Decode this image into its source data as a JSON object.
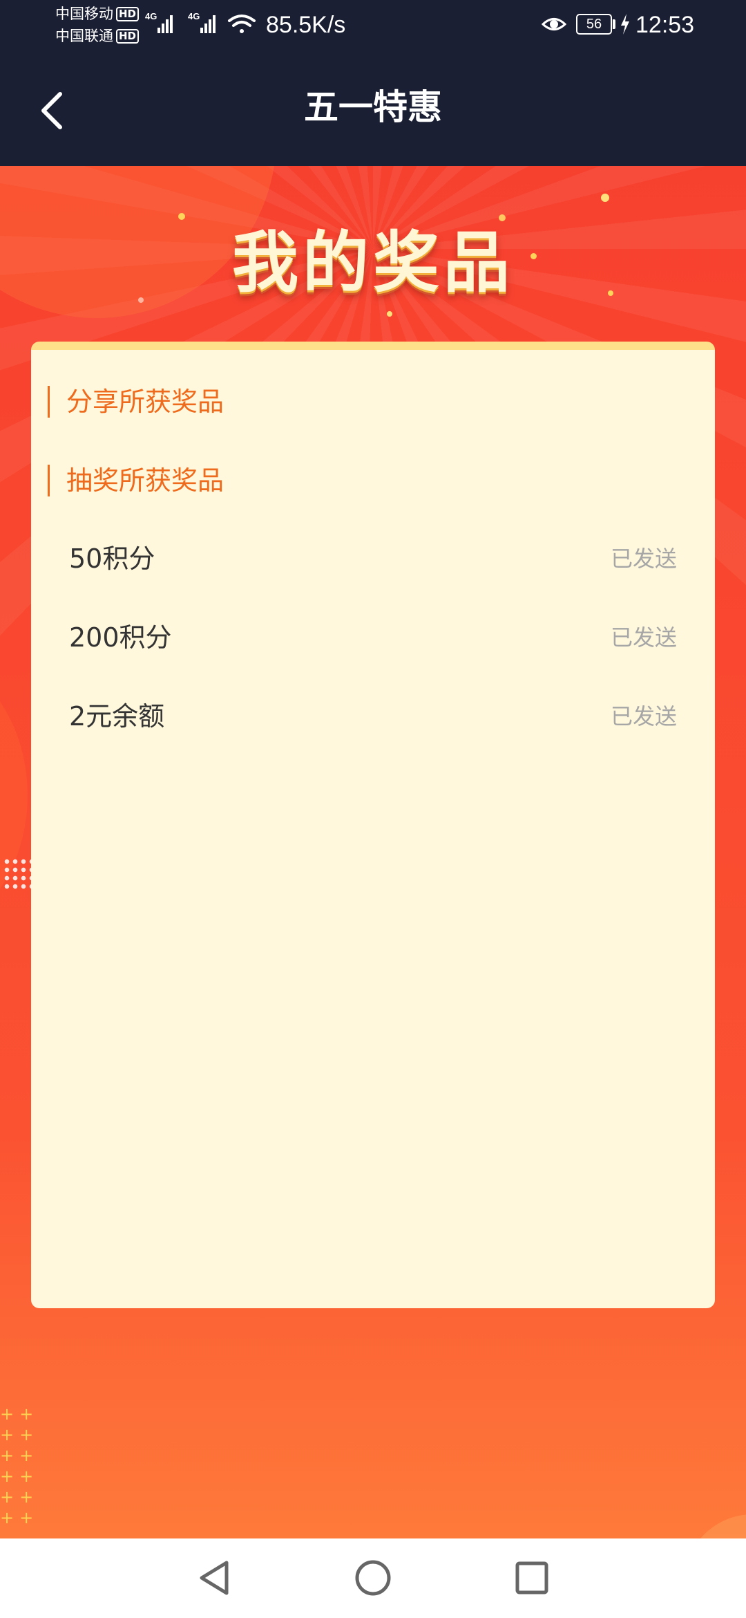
{
  "status_bar": {
    "carrier_1": "中国移动",
    "carrier_2": "中国联通",
    "hd_badge": "HD",
    "network_type": "4G",
    "net_speed": "85.5K/s",
    "battery_level": "56",
    "time": "12:53"
  },
  "app_bar": {
    "title": "五一特惠",
    "back_icon": "chevron-left-icon"
  },
  "banner": {
    "heading": "我的奖品"
  },
  "card": {
    "sections": [
      {
        "title": "分享所获奖品"
      },
      {
        "title": "抽奖所获奖品"
      }
    ],
    "prizes": [
      {
        "name": "50积分",
        "status": "已发送"
      },
      {
        "name": "200积分",
        "status": "已发送"
      },
      {
        "name": "2元余额",
        "status": "已发送"
      }
    ]
  },
  "nav_bar": {
    "back": "triangle-back-icon",
    "home": "circle-home-icon",
    "recents": "square-recents-icon"
  },
  "colors": {
    "header_bg": "#1b1f33",
    "accent_orange": "#ee6b1e",
    "card_bg": "#fff8dc",
    "status_gray": "#a6a6a6"
  }
}
